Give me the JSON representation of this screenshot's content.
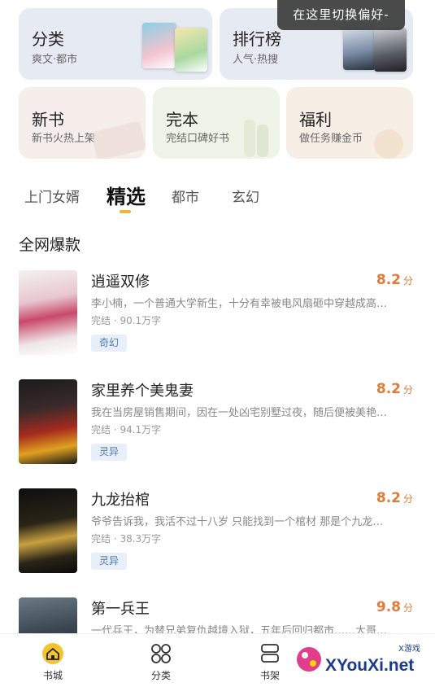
{
  "tooltip": "在这里切换偏好-",
  "cards": {
    "fenlei": {
      "title": "分类",
      "subtitle": "爽文·都市"
    },
    "paihang": {
      "title": "排行榜",
      "subtitle": "人气·热搜"
    },
    "xinshu": {
      "title": "新书",
      "subtitle": "新书火热上架"
    },
    "wanben": {
      "title": "完本",
      "subtitle": "完结口碑好书"
    },
    "fuli": {
      "title": "福利",
      "subtitle": "做任务赚金币"
    }
  },
  "tabs": [
    "上门女婿",
    "精选",
    "都市",
    "玄幻"
  ],
  "active_tab": "精选",
  "section_title": "全网爆款",
  "books": [
    {
      "title": "逍遥双修",
      "score": "8.2",
      "score_unit": "分",
      "desc": "李小楠，一个普通大学新生，十分有幸被电风扇砸中穿越成高…",
      "meta": "完结 · 90.1万字",
      "tag": "奇幻"
    },
    {
      "title": "家里养个美鬼妻",
      "score": "8.2",
      "score_unit": "分",
      "desc": "我在当房屋销售期间，因在一处凶宅别墅过夜，随后便被美艳…",
      "meta": "完结 · 94.1万字",
      "tag": "灵异"
    },
    {
      "title": "九龙抬棺",
      "score": "8.2",
      "score_unit": "分",
      "desc": "爷爷告诉我，我活不过十八岁 只能找到一个棺材 那是个九龙…",
      "meta": "完结 · 38.3万字",
      "tag": "灵异"
    },
    {
      "title": "第一兵王",
      "score": "9.8",
      "score_unit": "分",
      "desc": "一代兵王，为替兄弟复仇越境入狱，五年后回归都市……大哥…",
      "meta": "",
      "tag": ""
    }
  ],
  "bottom_nav": [
    {
      "label": "书城",
      "icon": "home-icon"
    },
    {
      "label": "分类",
      "icon": "grid-icon"
    },
    {
      "label": "书架",
      "icon": "bookshelf-icon"
    }
  ],
  "watermark": {
    "brand": "XYouXi.net",
    "small": "X游戏"
  },
  "colors": {
    "accent": "#f4b43a",
    "score": "#e07b3a",
    "tag_text": "#4f7bb3",
    "tag_bg": "#e8eff8"
  }
}
